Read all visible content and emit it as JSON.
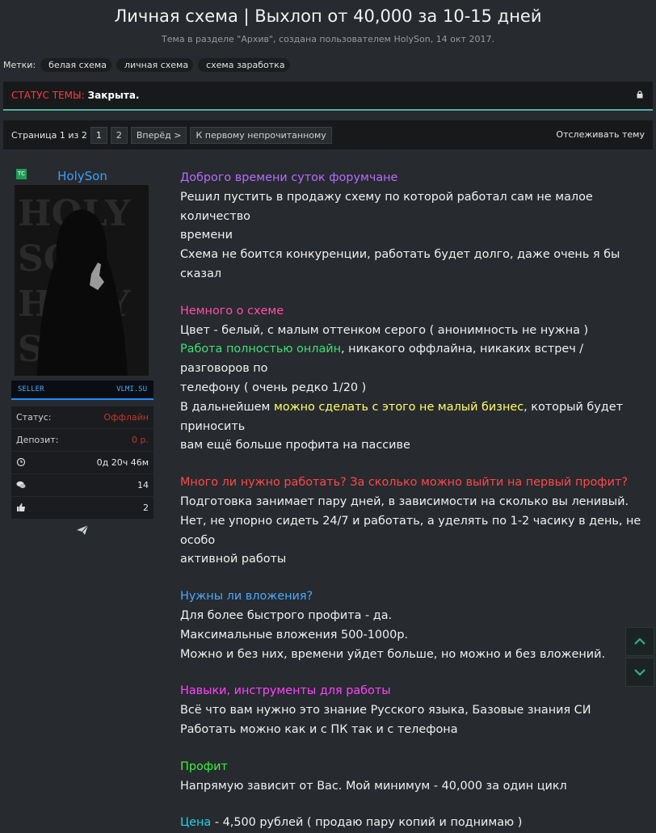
{
  "thread": {
    "title": "Личная схема | Выхлоп от 40,000 за 10-15 дней",
    "subtitle": "Тема в разделе \"Архив\", создана пользователем HolySon, 14 окт 2017."
  },
  "tags": {
    "label": "Метки:",
    "items": [
      "белая схема",
      "личная схема",
      "схема заработка"
    ]
  },
  "status": {
    "label": "СТАТУС ТЕМЫ:",
    "value": "Закрыта."
  },
  "pagination": {
    "page_text": "Страница 1 из 2",
    "pages": [
      "1",
      "2"
    ],
    "next": "Вперёд >",
    "first_unread": "К первому непрочитанному",
    "watch": "Отслеживать тему"
  },
  "user": {
    "badge": "ТС",
    "name": "HolySon",
    "avatar_text": [
      "HOLY",
      "SON",
      "HOLY",
      "SON"
    ],
    "userbar_left": "SELLER",
    "userbar_right": "VLMI.SU",
    "rows": [
      {
        "key": "Статус:",
        "value": "Оффлайн"
      },
      {
        "key": "Депозит:",
        "value": "0 р."
      },
      {
        "icon": "clock-icon",
        "value": "0д 20ч 46м"
      },
      {
        "icon": "messages-icon",
        "value": "14"
      },
      {
        "icon": "thumbs-up-icon",
        "value": "2"
      }
    ]
  },
  "post": {
    "l1": "Доброго времени суток форумчане",
    "l2": "Решил пустить в продажу схему по которой работал сам не малое количество",
    "l3": "времени",
    "l4": "Схема не боится конкуренции, работать будет долго, даже очень я бы сказал",
    "h_scheme": "Немного о схеме",
    "l5": "Цвет - белый, с малым оттенком серого ( анонимность не нужна )",
    "l6a": "Работа полностью онлайн",
    "l6b": ", никакого оффлайна, никаких встреч / разговоров по",
    "l7": "телефону ( очень редко 1/20 )",
    "l8a": "В дальнейшем ",
    "l8b": "можно сделать с этого не малый бизнес",
    "l8c": ", который будет приносить",
    "l9": "вам ещё больше профита на пассиве",
    "h_work": "Много ли нужно работать? За сколько можно выйти на первый профит?",
    "l10": "Подготовка занимает пару дней, в зависимости на сколько вы ленивый.",
    "l11": "Нет, не упорно сидеть 24/7 и работать, а уделять по 1-2 часику в день, не особо",
    "l12": "активной работы",
    "h_invest": "Нужны ли вложения?",
    "l13": "Для более быстрого профита - да.",
    "l14": "Максимальные вложения 500-1000р.",
    "l15": "Можно и без них, времени уйдет больше, но можно и без вложений.",
    "h_skills": "Навыки, инструменты для работы",
    "l16": "Всё что вам нужно это знание Русского языка, Базовые знания СИ",
    "l17": "Работать можно как и с ПК так и с телефона",
    "h_profit": "Профит",
    "l18": "Напрямую зависит от Вас. Мой минимум - 40,000 за один цикл",
    "price_label": "Цена",
    "price_text": " - 4,500 рублей ( продаю пару копий и поднимаю )"
  },
  "colors": {
    "accent_teal": "#4fb3a0",
    "username_blue": "#3aa0ff",
    "offline_red": "#c0392b"
  }
}
